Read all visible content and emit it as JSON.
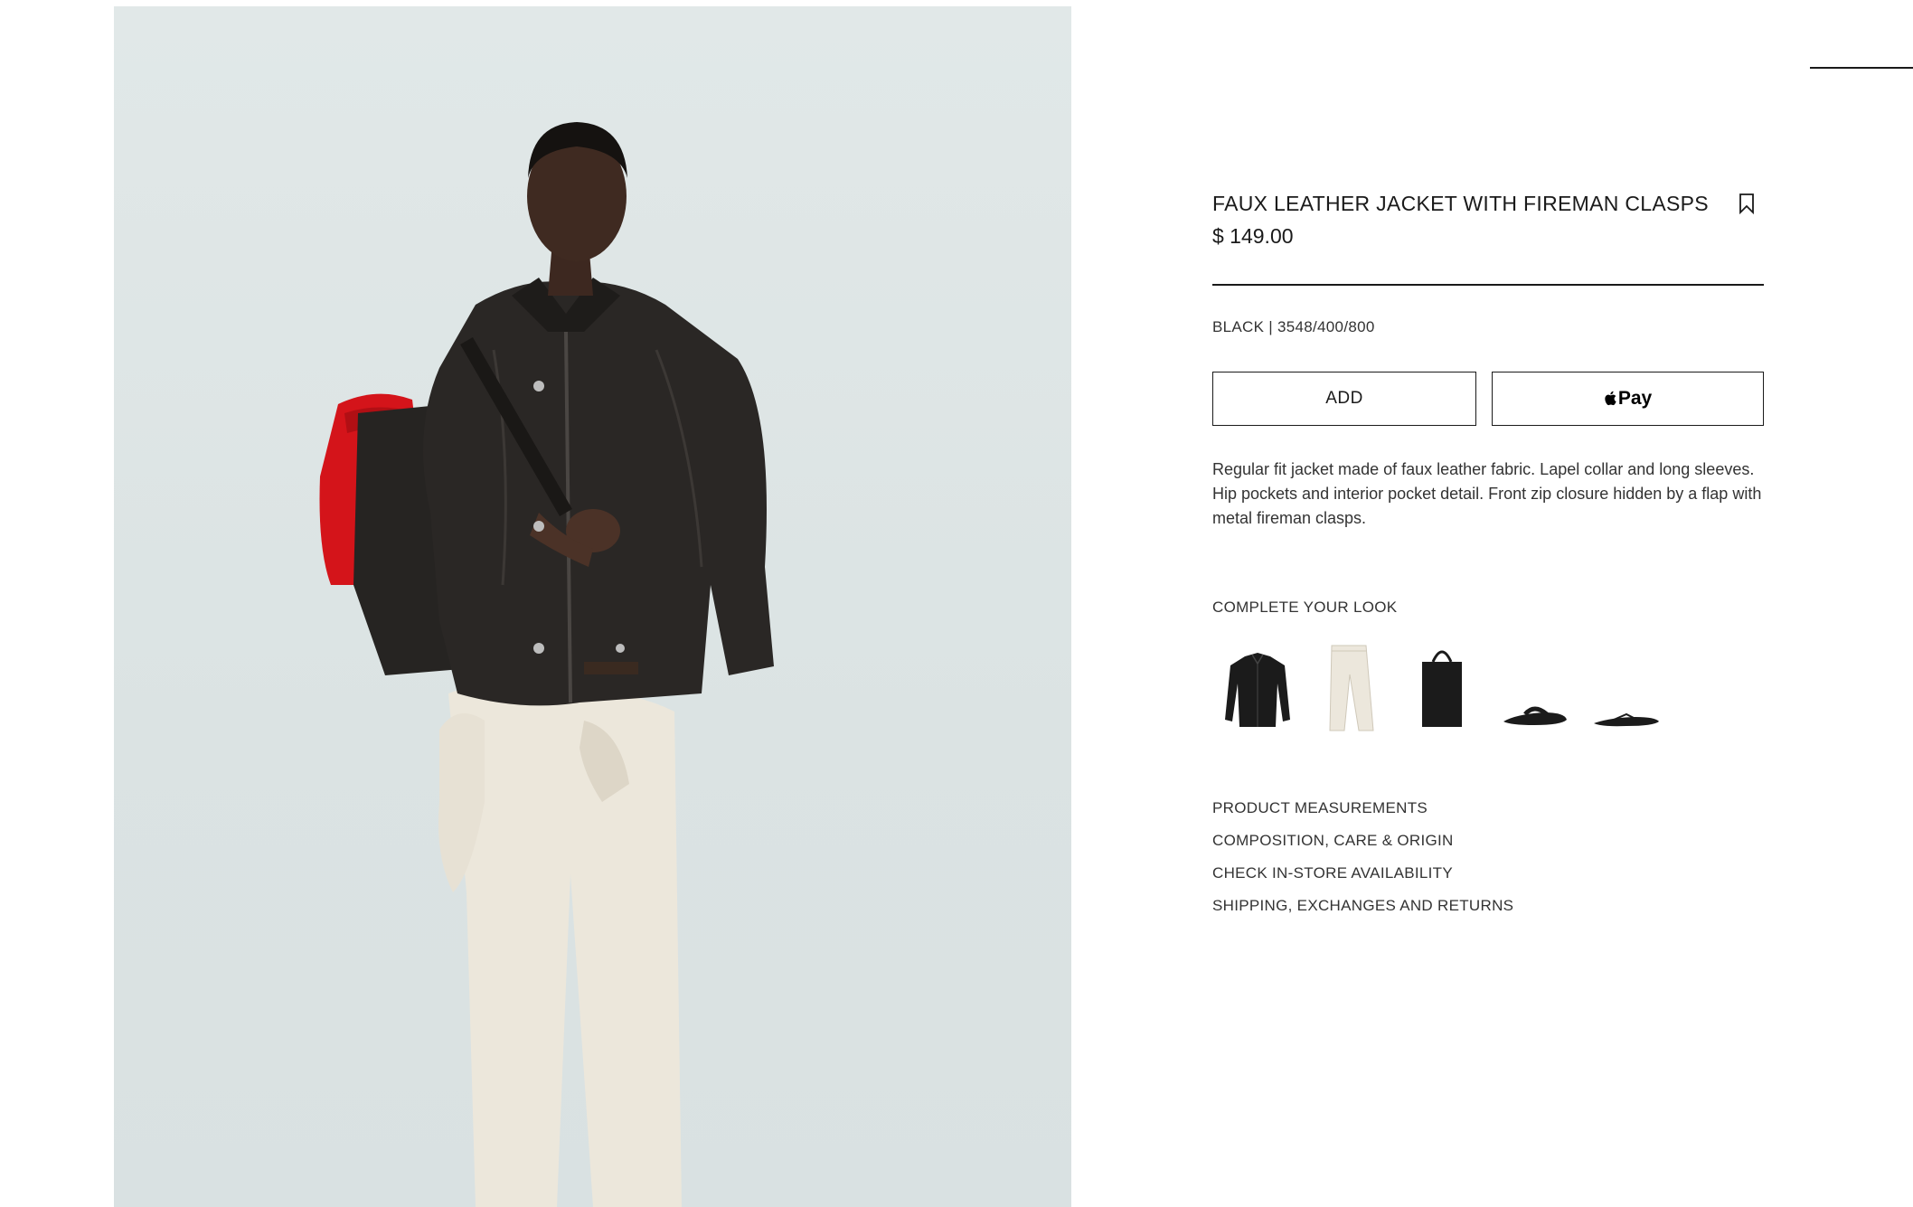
{
  "product": {
    "title": "FAUX LEATHER JACKET WITH FIREMAN CLASPS",
    "price": "$ 149.00",
    "color_ref": "BLACK | 3548/400/800",
    "description": "Regular fit jacket made of faux leather fabric. Lapel collar and long sleeves. Hip pockets and interior pocket detail. Front zip closure hidden by a flap with metal fireman clasps."
  },
  "actions": {
    "add_label": "ADD",
    "pay_label": "Pay"
  },
  "look": {
    "heading": "COMPLETE YOUR LOOK",
    "items": [
      "black-shirt",
      "white-trousers",
      "black-tote-bag",
      "black-sandals",
      "black-flip-flops"
    ]
  },
  "links": [
    "PRODUCT MEASUREMENTS",
    "COMPOSITION, CARE & ORIGIN",
    "CHECK IN-STORE AVAILABILITY",
    "SHIPPING, EXCHANGES AND RETURNS"
  ],
  "icons": {
    "bookmark": "bookmark-icon",
    "apple": "apple-icon"
  },
  "colors": {
    "text": "#1a1a1a",
    "image_background": "#dfe6e6",
    "bag_red": "#d4141a"
  }
}
